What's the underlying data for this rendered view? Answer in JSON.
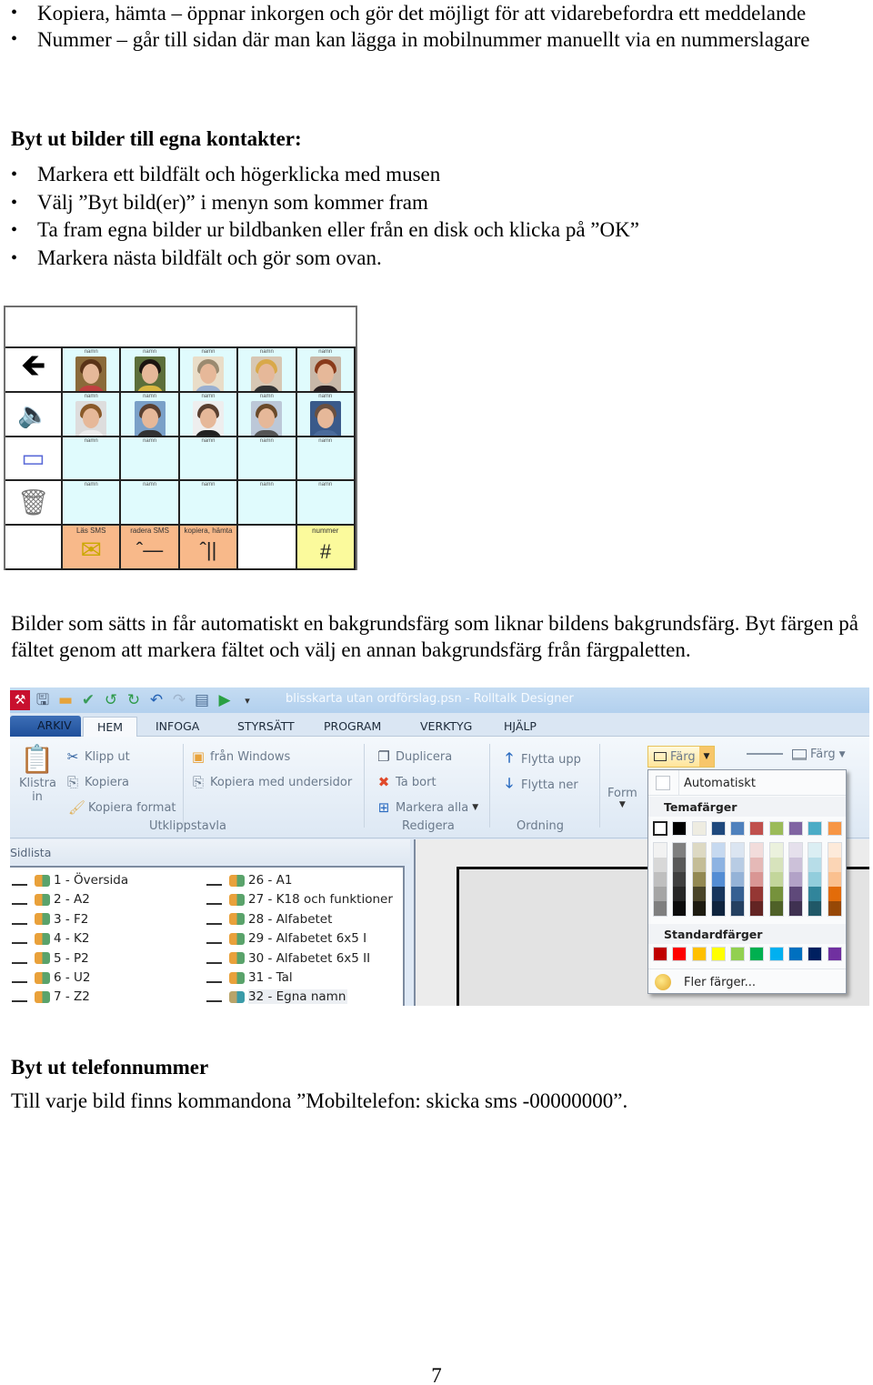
{
  "intro_bullets": [
    "Kopiera, hämta – öppnar inkorgen och gör det möjligt för att vidarebefordra ett meddelande",
    "Nummer – går till sidan där man kan lägga in mobilnummer manuellt via en nummerslagare"
  ],
  "section1": {
    "heading": "Byt ut bilder till egna kontakter:",
    "bullets": [
      "Markera ett bildfält och högerklicka med musen",
      "Välj ”Byt bild(er)” i menyn som kommer fram",
      "Ta fram egna bilder ur bildbanken eller från en disk och klicka på ”OK”",
      "Markera nästa bildfält och gör som ovan."
    ]
  },
  "bullet_glyph": "•",
  "board": {
    "side_icons": [
      "back-arrow-icon",
      "speaker-icon",
      "eraser-icon",
      "trash-can-icon",
      ""
    ],
    "side_glyphs": [
      "🡸",
      "🔈",
      "▭",
      "🗑",
      ""
    ],
    "contact_label": "namn",
    "contact_rows_with_photos": 2,
    "contact_rows_empty": 2,
    "bottom_row": [
      {
        "label": "Läs SMS",
        "symbol": "✉",
        "color": "orange"
      },
      {
        "label": "radera SMS",
        "symbol": "ˆ—",
        "color": "orange"
      },
      {
        "label": "kopiera, hämta",
        "symbol": "ˆ||",
        "color": "orange"
      },
      {
        "label": "",
        "symbol": "",
        "color": "blank"
      },
      {
        "label": "nummer",
        "symbol": "#",
        "color": "yellow"
      }
    ],
    "colors": {
      "contact_bg": "#e0fbfd",
      "orange": "#f8b98a",
      "yellow": "#fbfa9c"
    }
  },
  "paragraph1": "Bilder som sätts in får automatiskt en bakgrundsfärg som liknar bildens bakgrundsfärg. Byt färgen på fältet genom att markera fältet och välj en annan bakgrundsfärg från färgpaletten.",
  "app": {
    "window_title": "blisskarta utan ordförslag.psn - Rolltalk Designer",
    "qat_icons": [
      "app-logo-icon",
      "save-icon",
      "open-folder-icon",
      "sync-icon",
      "undo-history-icon",
      "redo-history-icon",
      "undo-icon",
      "redo-icon",
      "preview-icon",
      "play-icon",
      "customize-icon"
    ],
    "tabs": [
      "ARKIV",
      "HEM",
      "INFOGA",
      "STYRSÄTT",
      "PROGRAM",
      "VERKTYG",
      "HJÄLP"
    ],
    "active_tab": "HEM",
    "ribbon": {
      "clipboard": {
        "paste_label": "Klistra in",
        "cut": "Klipp ut",
        "copy": "Kopiera",
        "copy_format": "Kopiera format",
        "from_windows": "från Windows",
        "copy_with_subpages": "Kopiera med undersidor",
        "group": "Utklippstavla"
      },
      "edit": {
        "duplicate": "Duplicera",
        "delete": "Ta bort",
        "select_all": "Markera alla",
        "group": "Redigera"
      },
      "arrange": {
        "move_up": "Flytta upp",
        "move_down": "Flytta ner",
        "group": "Ordning"
      },
      "form": "Form",
      "color_button": "Färg",
      "color_button2": "Färg"
    },
    "page_list": {
      "title": "Sidlista",
      "left": [
        "1 - Översida",
        "2 - A2",
        "3 - F2",
        "4 - K2",
        "5 - P2",
        "6 - U2",
        "7 - Z2"
      ],
      "right": [
        "26 - A1",
        "27 - K18 och funktioner",
        "28 -  Alfabetet",
        "29 -  Alfabetet 6x5 I",
        "30 - Alfabetet 6x5 II",
        "31 - Tal",
        "32 - Egna namn"
      ],
      "selected": "32 - Egna namn"
    },
    "palette": {
      "automatic": "Automatiskt",
      "theme_heading": "Temafärger",
      "theme_colors": [
        "#ffffff",
        "#000000",
        "#eeece1",
        "#1f497d",
        "#4f81bd",
        "#c0504d",
        "#9bbb59",
        "#8064a2",
        "#4bacc6",
        "#f79646"
      ],
      "theme_shades": [
        [
          "#f2f2f2",
          "#d8d8d8",
          "#bfbfbf",
          "#a5a5a5",
          "#7f7f7f"
        ],
        [
          "#7f7f7f",
          "#595959",
          "#3f3f3f",
          "#262626",
          "#0c0c0c"
        ],
        [
          "#ddd9c3",
          "#c4bd97",
          "#938953",
          "#494429",
          "#1d1b10"
        ],
        [
          "#c6d9f0",
          "#8db3e2",
          "#548dd4",
          "#17365d",
          "#0f243e"
        ],
        [
          "#dbe5f1",
          "#b8cce4",
          "#95b3d7",
          "#366092",
          "#244061"
        ],
        [
          "#f2dcdb",
          "#e5b9b7",
          "#d99694",
          "#953734",
          "#632423"
        ],
        [
          "#ebf1dd",
          "#d7e3bc",
          "#c3d69b",
          "#76923c",
          "#4f6128"
        ],
        [
          "#e5e0ec",
          "#ccc1d9",
          "#b2a2c7",
          "#5f497a",
          "#3f3151"
        ],
        [
          "#dbeef3",
          "#b7dde8",
          "#92cddc",
          "#31859b",
          "#205867"
        ],
        [
          "#fdeada",
          "#fbd5b5",
          "#fac08f",
          "#e36c09",
          "#974806"
        ]
      ],
      "standard_heading": "Standardfärger",
      "standard_colors": [
        "#c00000",
        "#ff0000",
        "#ffc000",
        "#ffff00",
        "#92d050",
        "#00b050",
        "#00b0f0",
        "#0070c0",
        "#002060",
        "#7030a0"
      ],
      "more_colors": "Fler färger..."
    }
  },
  "section2": {
    "heading": "Byt ut telefonnummer",
    "text": "Till varje bild finns kommandona ”Mobiltelefon: skicka sms -00000000”."
  },
  "page_number": "7"
}
